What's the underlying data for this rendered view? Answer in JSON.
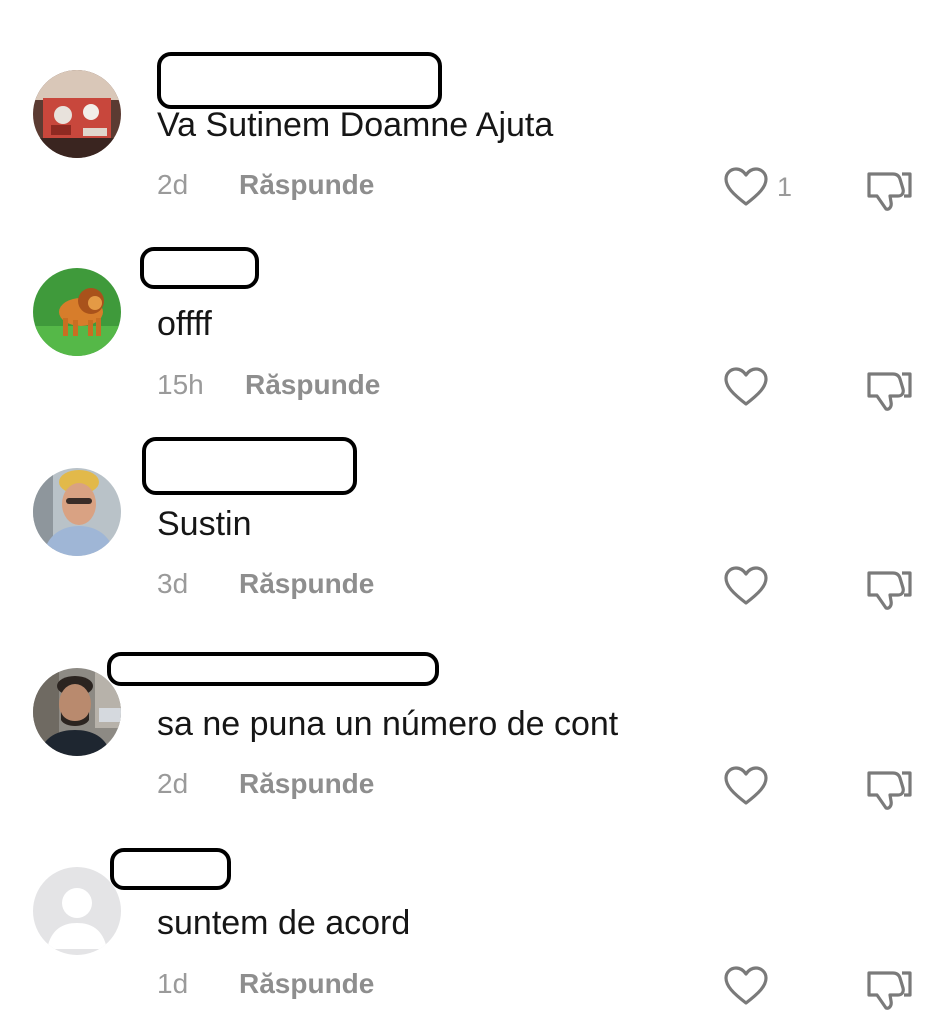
{
  "comments": [
    {
      "text": "Va Sutinem Doamne Ajuta",
      "time": "2d",
      "reply_label": "Răspunde",
      "like_count": "1",
      "avatar": "avatar-table-photo"
    },
    {
      "text": "offff",
      "time": "15h",
      "reply_label": "Răspunde",
      "like_count": "",
      "avatar": "avatar-lion-illustration"
    },
    {
      "text": "Sustin",
      "time": "3d",
      "reply_label": "Răspunde",
      "like_count": "",
      "avatar": "avatar-woman-photo"
    },
    {
      "text": "sa ne puna un número de cont",
      "time": "2d",
      "reply_label": "Răspunde",
      "like_count": "",
      "avatar": "avatar-man-photo"
    },
    {
      "text": "suntem de acord",
      "time": "1d",
      "reply_label": "Răspunde",
      "like_count": "",
      "avatar": "avatar-default-placeholder"
    }
  ],
  "icons": {
    "like": "heart-outline-icon",
    "dislike": "thumbs-down-outline-icon"
  },
  "colors": {
    "text": "#161616",
    "meta": "#9a9a9a",
    "reply": "#8e8e8e",
    "icon": "#7a7a7a",
    "background": "#ffffff"
  }
}
